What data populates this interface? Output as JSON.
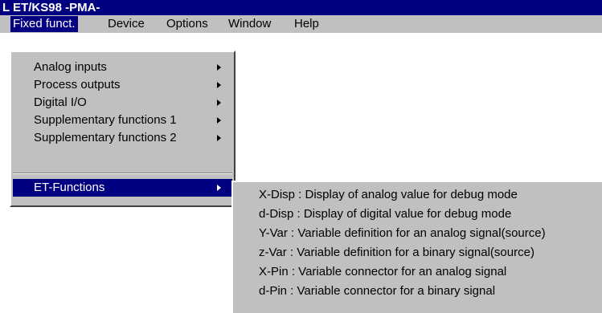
{
  "window": {
    "title": "L ET/KS98 -PMA-"
  },
  "menubar": {
    "items": [
      {
        "label": "Fixed funct."
      },
      {
        "label": "Device"
      },
      {
        "label": "Options"
      },
      {
        "label": "Window"
      },
      {
        "label": "Help"
      }
    ]
  },
  "dropdown": {
    "items": [
      {
        "label": "Analog inputs"
      },
      {
        "label": "Process outputs"
      },
      {
        "label": "Digital I/O"
      },
      {
        "label": "Supplementary functions 1"
      },
      {
        "label": "Supplementary functions 2"
      },
      {
        "label": "ET-Functions"
      }
    ]
  },
  "submenu": {
    "items": [
      {
        "label": "X-Disp : Display of analog value for debug mode"
      },
      {
        "label": "d-Disp : Display of digital value for debug mode"
      },
      {
        "label": "Y-Var : Variable definition for an analog signal(source)"
      },
      {
        "label": "z-Var : Variable definition for a binary signal(source)"
      },
      {
        "label": "X-Pin : Variable connector for an analog signal"
      },
      {
        "label": "d-Pin : Variable connector for a binary signal"
      }
    ]
  },
  "colors": {
    "titlebar": "#000080",
    "menu_face": "#c0c0c0",
    "highlight": "#000080"
  }
}
